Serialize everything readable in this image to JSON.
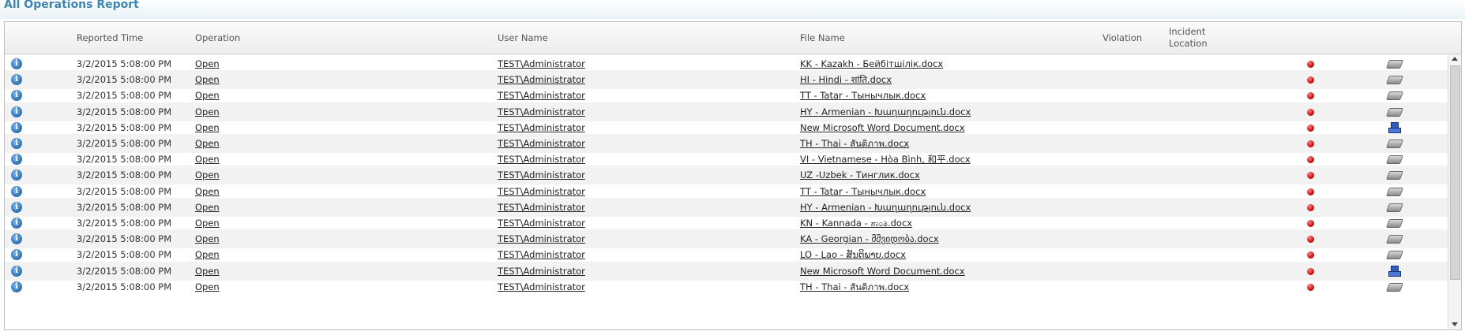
{
  "title": "All Operations Report",
  "columns": {
    "reported_time": "Reported Time",
    "operation": "Operation",
    "user_name": "User Name",
    "file_name": "File Name",
    "violation": "Violation",
    "incident_location_1": "Incident",
    "incident_location_2": "Location"
  },
  "colors": {
    "title": "#3a86b4",
    "violation_dot": "#d01010",
    "row_alt": "#f2f2f2"
  },
  "rows": [
    {
      "time": "3/2/2015 5:08:00 PM",
      "operation": "Open",
      "user": "TEST\\Administrator",
      "file": "KK - Kazakh - Бейбітшілік.docx",
      "location_icon": "drive-icon"
    },
    {
      "time": "3/2/2015 5:08:00 PM",
      "operation": "Open",
      "user": "TEST\\Administrator",
      "file": "HI - Hindi - शांति.docx",
      "location_icon": "drive-icon"
    },
    {
      "time": "3/2/2015 5:08:00 PM",
      "operation": "Open",
      "user": "TEST\\Administrator",
      "file": "TT - Tatar - Тынычлык.docx",
      "location_icon": "drive-icon"
    },
    {
      "time": "3/2/2015 5:08:00 PM",
      "operation": "Open",
      "user": "TEST\\Administrator",
      "file": "HY - Armenian - Խաղաղություն.docx",
      "location_icon": "drive-icon"
    },
    {
      "time": "3/2/2015 5:08:00 PM",
      "operation": "Open",
      "user": "TEST\\Administrator",
      "file": "New Microsoft Word Document.docx",
      "location_icon": "network-icon"
    },
    {
      "time": "3/2/2015 5:08:00 PM",
      "operation": "Open",
      "user": "TEST\\Administrator",
      "file": "TH - Thai - สันติภาพ.docx",
      "location_icon": "drive-icon"
    },
    {
      "time": "3/2/2015 5:08:00 PM",
      "operation": "Open",
      "user": "TEST\\Administrator",
      "file": "VI - Vietnamese - Hòa Bình, 和平.docx",
      "location_icon": "drive-icon"
    },
    {
      "time": "3/2/2015 5:08:00 PM",
      "operation": "Open",
      "user": "TEST\\Administrator",
      "file": "UZ -Uzbek - Тинглик.docx",
      "location_icon": "drive-icon"
    },
    {
      "time": "3/2/2015 5:08:00 PM",
      "operation": "Open",
      "user": "TEST\\Administrator",
      "file": "TT - Tatar - Тынычлык.docx",
      "location_icon": "drive-icon"
    },
    {
      "time": "3/2/2015 5:08:00 PM",
      "operation": "Open",
      "user": "TEST\\Administrator",
      "file": "HY - Armenian - Խաղաղություն.docx",
      "location_icon": "drive-icon"
    },
    {
      "time": "3/2/2015 5:08:00 PM",
      "operation": "Open",
      "user": "TEST\\Administrator",
      "file": "KN - Kannada - ಶಾಂತಿ.docx",
      "location_icon": "drive-icon"
    },
    {
      "time": "3/2/2015 5:08:00 PM",
      "operation": "Open",
      "user": "TEST\\Administrator",
      "file": "KA - Georgian - მშვიდობა.docx",
      "location_icon": "drive-icon"
    },
    {
      "time": "3/2/2015 5:08:00 PM",
      "operation": "Open",
      "user": "TEST\\Administrator",
      "file": "LO - Lao - ສັນຕິພາບ.docx",
      "location_icon": "drive-icon"
    },
    {
      "time": "3/2/2015 5:08:00 PM",
      "operation": "Open",
      "user": "TEST\\Administrator",
      "file": "New Microsoft Word Document.docx",
      "location_icon": "network-icon"
    },
    {
      "time": "3/2/2015 5:08:00 PM",
      "operation": "Open",
      "user": "TEST\\Administrator",
      "file": "TH - Thai - สันติภาพ.docx",
      "location_icon": "drive-icon"
    }
  ]
}
